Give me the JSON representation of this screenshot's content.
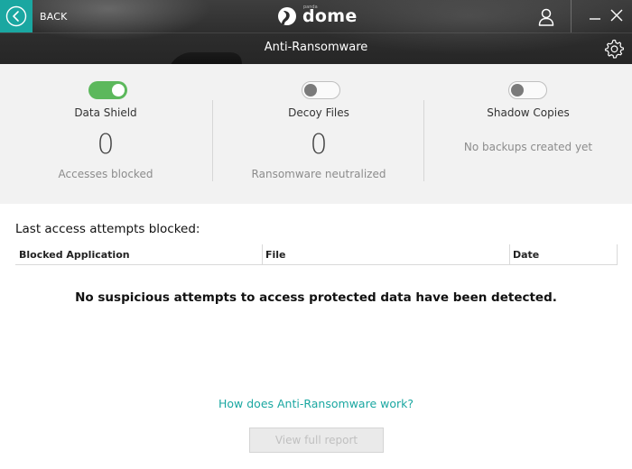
{
  "header": {
    "back_label": "BACK",
    "logo_text": "dome",
    "logo_small": "panda",
    "title": "Anti-Ransomware"
  },
  "features": [
    {
      "label": "Data Shield",
      "toggle_on": true,
      "count": "0",
      "sub": "Accesses blocked"
    },
    {
      "label": "Decoy Files",
      "toggle_on": false,
      "count": "0",
      "sub": "Ransomware neutralized"
    },
    {
      "label": "Shadow Copies",
      "toggle_on": false,
      "note": "No backups created yet"
    }
  ],
  "table": {
    "title": "Last access attempts blocked:",
    "columns": [
      "Blocked Application",
      "File",
      "Date"
    ],
    "empty_message": "No suspicious attempts to access protected data have been detected."
  },
  "footer": {
    "help_link": "How does Anti-Ransomware work?",
    "report_button": "View full report"
  },
  "colors": {
    "accent": "#1aa7a1",
    "toggle_on": "#5cb85c",
    "header_bg": "#2d2d2d",
    "panel_bg": "#f2f2f2"
  },
  "icons": [
    "back-arrow-icon",
    "dome-logo-icon",
    "user-icon",
    "minimize-icon",
    "close-icon",
    "gear-icon"
  ]
}
